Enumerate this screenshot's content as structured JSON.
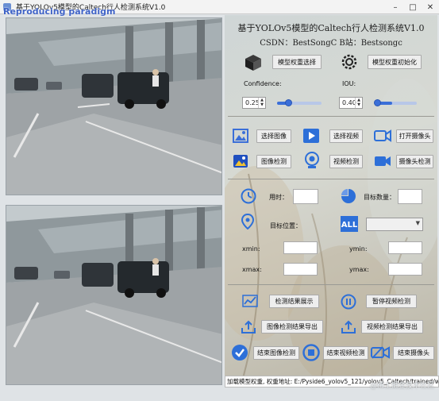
{
  "window": {
    "title": "基于YOLOv5模型的Caltech行人检测系统V1.0",
    "overlay_label": "Reproducing paradigm",
    "buttons": {
      "minimize": "–",
      "maximize": "□",
      "close": "✕"
    }
  },
  "header": {
    "title": "基于YOLOv5模型的Caltech行人检测系统V1.0",
    "subtitle": "CSDN：BestSongC  B站：Bestsongc"
  },
  "model": {
    "select_label": "模型权重选择",
    "init_label": "模型权重初始化",
    "confidence_label": "Confidence:",
    "confidence_value": "0.25",
    "confidence_level": 0.25,
    "iou_label": "IOU:",
    "iou_value": "0.40",
    "iou_level": 0.4
  },
  "io_buttons": {
    "select_image": "选择图像",
    "select_video": "选择视频",
    "open_camera": "打开摄像头",
    "image_detect": "图像检测",
    "video_detect": "视频检测",
    "camera_detect": "摄像头检测"
  },
  "results": {
    "time_label": "用时：",
    "target_count_label": "目标数量：",
    "target_position_label": "目标位置：",
    "xmin_label": "xmin:",
    "ymin_label": "ymin:",
    "xmax_label": "xmax:",
    "ymax_label": "ymax:"
  },
  "actions": {
    "show_results": "检测结果展示",
    "pause_video": "暂停视频检测",
    "export_image": "图像检测结果导出",
    "export_video": "视频检测结果导出",
    "end_image": "结束图像检测",
    "end_video": "结束视频检测",
    "end_camera": "结束摄像头"
  },
  "status": {
    "text": "加载模型权重, 权重地址: E:/Pyside6_yolov5_121/yolov5_Caltech/trained/weights/best.pt",
    "credit": "@稀土掘金技术社区"
  },
  "colors": {
    "accent": "#3b6fd8",
    "panel_bg": "#d3d6d1",
    "title_watermark": "#3f63c7"
  }
}
